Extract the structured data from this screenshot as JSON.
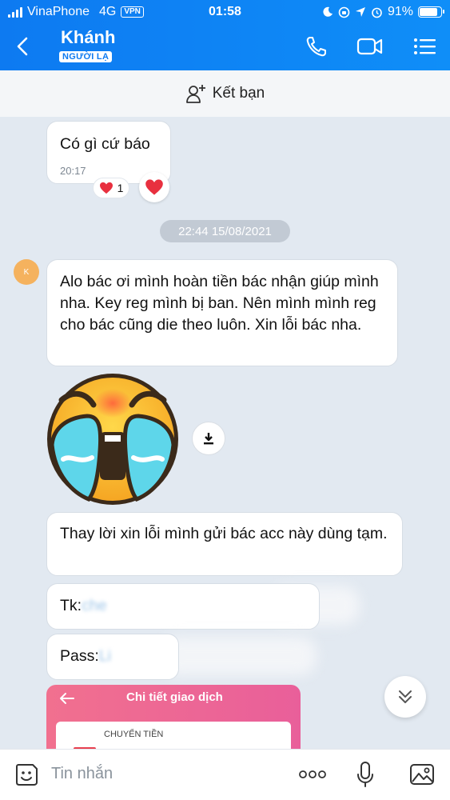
{
  "status_bar": {
    "carrier": "VinaPhone",
    "network": "4G",
    "vpn": "VPN",
    "time": "01:58",
    "battery": "91%",
    "battery_level": 0.91
  },
  "header": {
    "contact_name": "Khánh",
    "badge": "NGƯỜI LẠ"
  },
  "add_friend": {
    "label": "Kết bạn"
  },
  "messages": {
    "m1": {
      "text": "Có gì cứ báo",
      "time": "20:17"
    },
    "reaction_count": "1",
    "date_separator": "22:44 15/08/2021",
    "avatar_initial": "K",
    "m2": {
      "text": "Alo bác ơi mình hoàn tiền bác nhận giúp mình nha. Key reg mình bị ban. Nên mình mình reg cho bác cũng die theo luôn. Xin lỗi bác nha."
    },
    "m3": {
      "text": "Thay lời xin lỗi mình gửi bác acc này dùng tạm."
    },
    "m4": {
      "prefix": "Tk:",
      "hidden": "che"
    },
    "m5": {
      "prefix": "Pass:",
      "hidden": "Li"
    },
    "transaction_card": {
      "title": "Chi tiết giao dịch",
      "label": "CHUYỂN TIỀN"
    }
  },
  "input": {
    "placeholder": "Tin nhắn"
  },
  "colors": {
    "header_blue": "#0d7af1",
    "chat_bg": "#e2e9f1",
    "heart_red": "#e8303f"
  }
}
